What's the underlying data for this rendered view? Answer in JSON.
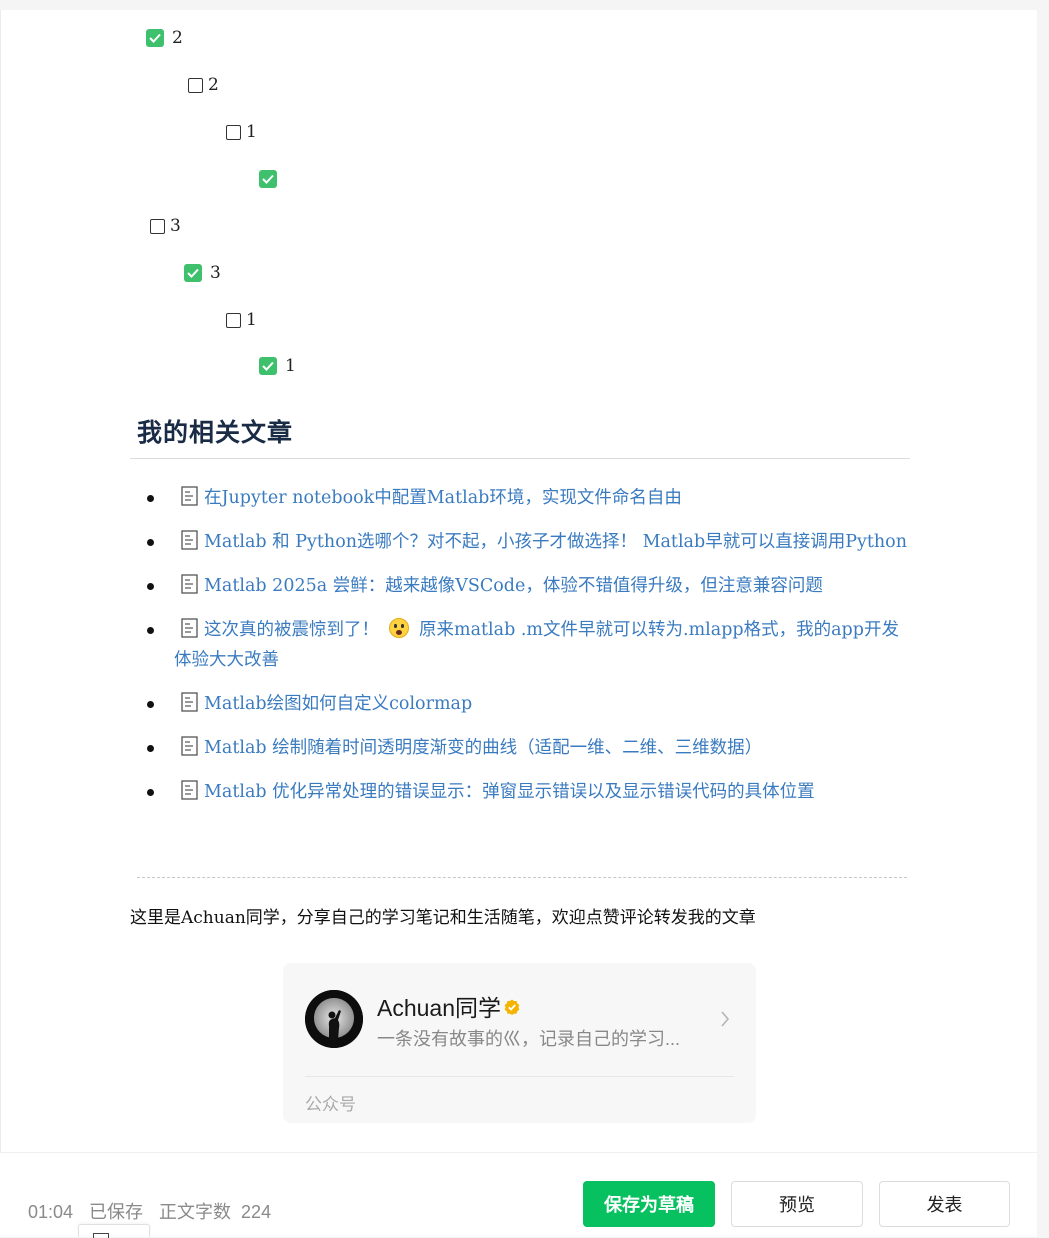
{
  "task_list": [
    {
      "label": "2",
      "checked": true
    },
    {
      "label": "2",
      "checked": false
    },
    {
      "label": "1",
      "checked": false
    },
    {
      "label": "",
      "checked": true
    },
    {
      "label": "3",
      "checked": false
    },
    {
      "label": "3",
      "checked": true
    },
    {
      "label": "1",
      "checked": false
    },
    {
      "label": "1",
      "checked": true
    }
  ],
  "related": {
    "heading": "我的相关文章",
    "articles": [
      {
        "icon": "document-icon",
        "title": "在Jupyter notebook中配置Matlab环境，实现文件命名自由"
      },
      {
        "icon": "document-icon",
        "title": "Matlab 和 Python选哪个？对不起，小孩子才做选择！ Matlab早就可以直接调用Python"
      },
      {
        "icon": "document-icon",
        "title": "Matlab 2025a 尝鲜：越来越像VSCode，体验不错值得升级，但注意兼容问题"
      },
      {
        "icon": "document-icon",
        "title_before": "这次真的被震惊到了！",
        "emoji": "screaming-face-emoji",
        "title_after": "原来matlab .m文件早就可以转为.mlapp格式，我的app开发体验大大改善"
      },
      {
        "icon": "document-icon",
        "title": "Matlab绘图如何自定义colormap"
      },
      {
        "icon": "document-icon",
        "title": "Matlab 绘制随着时间透明度渐变的曲线（适配一维、二维、三维数据）"
      },
      {
        "icon": "document-icon",
        "title": "Matlab 优化异常处理的错误显示：弹窗显示错误以及显示错误代码的具体位置"
      }
    ]
  },
  "intro": "这里是Achuan同学，分享自己的学习笔记和生活随笔，欢迎点赞评论转发我的文章",
  "account_card": {
    "name": "Achuan同学",
    "description": "一条没有故事的巛，记录自己的学习...",
    "type_label": "公众号",
    "verified_color": "#f5b400"
  },
  "footer": {
    "time": "01:04",
    "saved_status": "已保存",
    "word_count_label": "正文字数",
    "word_count": "224",
    "save_draft_label": "保存为草稿",
    "preview_label": "预览",
    "publish_label": "发表",
    "accent_color": "#07c160"
  }
}
